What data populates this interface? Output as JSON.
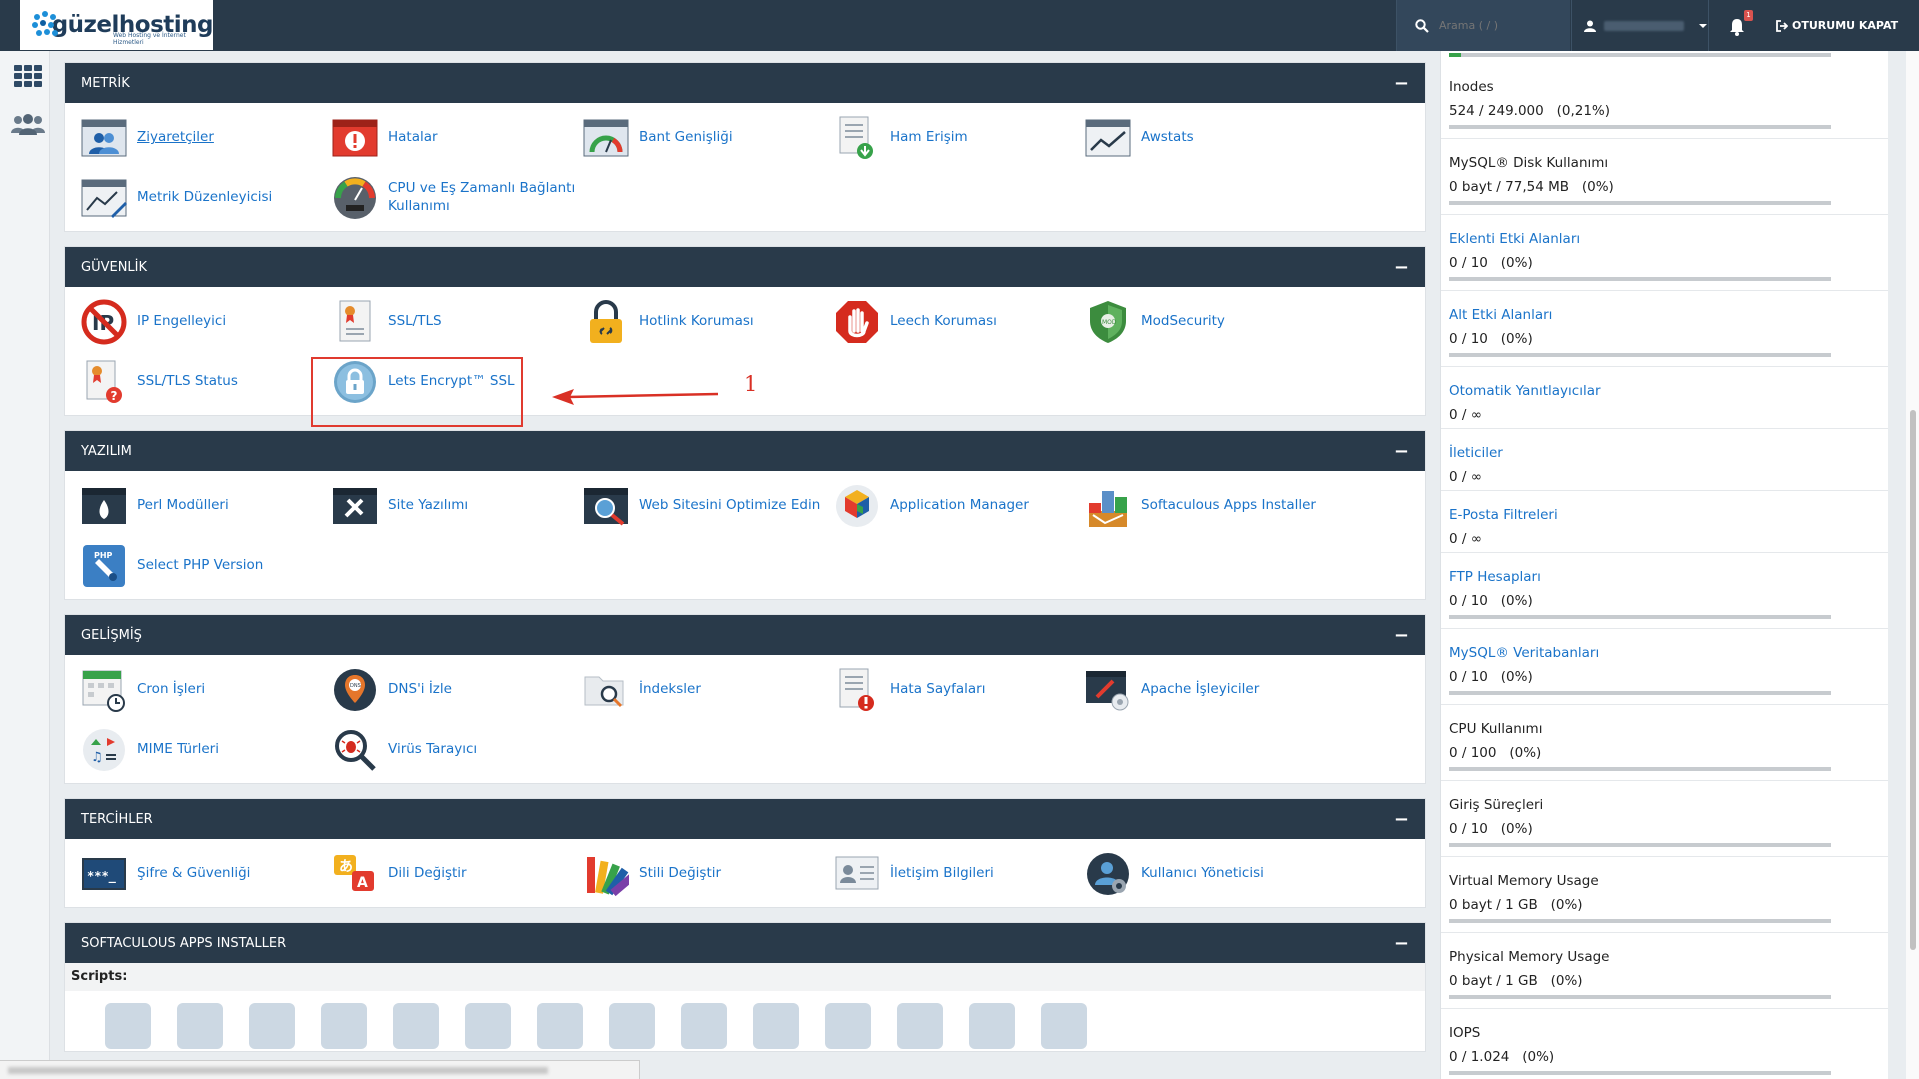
{
  "topbar": {
    "logo_text": "güzelhosting",
    "logo_sub": "Web Hosting ve İnternet Hizmetleri",
    "search_placeholder": "Arama ( / )",
    "notification_count": "1",
    "logout_label": "OTURUMU KAPAT"
  },
  "sections": [
    {
      "title": "METRİK",
      "items": [
        {
          "label": "Ziyaretçiler",
          "icon": "visitors-icon"
        },
        {
          "label": "Hatalar",
          "icon": "errors-icon"
        },
        {
          "label": "Bant Genişliği",
          "icon": "bandwidth-icon"
        },
        {
          "label": "Ham Erişim",
          "icon": "raw-access-icon"
        },
        {
          "label": "Awstats",
          "icon": "awstats-icon"
        },
        {
          "label": "Metrik Düzenleyicisi",
          "icon": "metrics-editor-icon"
        },
        {
          "label": "CPU ve Eş Zamanlı Bağlantı Kullanımı",
          "icon": "cpu-usage-icon"
        }
      ]
    },
    {
      "title": "GÜVENLİK",
      "items": [
        {
          "label": "IP Engelleyici",
          "icon": "ip-blocker-icon"
        },
        {
          "label": "SSL/TLS",
          "icon": "ssl-tls-icon"
        },
        {
          "label": "Hotlink Koruması",
          "icon": "hotlink-lock-icon"
        },
        {
          "label": "Leech Koruması",
          "icon": "leech-hand-icon"
        },
        {
          "label": "ModSecurity",
          "icon": "modsecurity-shield-icon"
        },
        {
          "label": "SSL/TLS Status",
          "icon": "ssl-status-icon"
        },
        {
          "label": "Lets Encrypt™ SSL",
          "icon": "lets-encrypt-lock-icon"
        }
      ]
    },
    {
      "title": "YAZILIM",
      "items": [
        {
          "label": "Perl Modülleri",
          "icon": "perl-icon"
        },
        {
          "label": "Site Yazılımı",
          "icon": "site-software-icon"
        },
        {
          "label": "Web Sitesini Optimize Edin",
          "icon": "optimize-icon"
        },
        {
          "label": "Application Manager",
          "icon": "app-manager-icon"
        },
        {
          "label": "Softaculous Apps Installer",
          "icon": "softaculous-icon"
        },
        {
          "label": "Select PHP Version",
          "icon": "php-icon"
        }
      ]
    },
    {
      "title": "GELİŞMİŞ",
      "items": [
        {
          "label": "Cron İşleri",
          "icon": "cron-calendar-icon"
        },
        {
          "label": "DNS'i İzle",
          "icon": "dns-pin-icon"
        },
        {
          "label": "İndeksler",
          "icon": "indexes-folder-icon"
        },
        {
          "label": "Hata Sayfaları",
          "icon": "error-pages-icon"
        },
        {
          "label": "Apache İşleyiciler",
          "icon": "apache-handlers-icon"
        },
        {
          "label": "MIME Türleri",
          "icon": "mime-types-icon"
        },
        {
          "label": "Virüs Tarayıcı",
          "icon": "virus-scanner-icon"
        }
      ]
    },
    {
      "title": "TERCİHLER",
      "items": [
        {
          "label": "Şifre & Güvenliği",
          "icon": "password-icon"
        },
        {
          "label": "Dili Değiştir",
          "icon": "language-icon"
        },
        {
          "label": "Stili Değiştir",
          "icon": "style-palette-icon"
        },
        {
          "label": "İletişim Bilgileri",
          "icon": "contact-card-icon"
        },
        {
          "label": "Kullanıcı Yöneticisi",
          "icon": "user-manager-icon"
        }
      ]
    }
  ],
  "softaculous": {
    "title": "SOFTACULOUS APPS INSTALLER",
    "scripts_label": "Scripts:"
  },
  "annotation": {
    "number": "1"
  },
  "stats": [
    {
      "name": "Inodes",
      "value": "524 / 249.000   (0,21%)",
      "link": false,
      "bar": true
    },
    {
      "name": "MySQL® Disk Kullanımı",
      "value": "0 bayt / 77,54 MB   (0%)",
      "link": false,
      "bar": true
    },
    {
      "name": "Eklenti Etki Alanları",
      "value": "0 / 10   (0%)",
      "link": true,
      "bar": true
    },
    {
      "name": "Alt Etki Alanları",
      "value": "0 / 10   (0%)",
      "link": true,
      "bar": true
    },
    {
      "name": "Otomatik Yanıtlayıcılar",
      "value": "0 / ∞",
      "link": true,
      "bar": false
    },
    {
      "name": "İleticiler",
      "value": "0 / ∞",
      "link": true,
      "bar": false
    },
    {
      "name": "E-Posta Filtreleri",
      "value": "0 / ∞",
      "link": true,
      "bar": false
    },
    {
      "name": "FTP Hesapları",
      "value": "0 / 10   (0%)",
      "link": true,
      "bar": true
    },
    {
      "name": "MySQL® Veritabanları",
      "value": "0 / 10   (0%)",
      "link": true,
      "bar": true
    },
    {
      "name": "CPU Kullanımı",
      "value": "0 / 100   (0%)",
      "link": false,
      "bar": true
    },
    {
      "name": "Giriş Süreçleri",
      "value": "0 / 10   (0%)",
      "link": false,
      "bar": true
    },
    {
      "name": "Virtual Memory Usage",
      "value": "0 bayt / 1 GB   (0%)",
      "link": false,
      "bar": true
    },
    {
      "name": "Physical Memory Usage",
      "value": "0 bayt / 1 GB   (0%)",
      "link": false,
      "bar": true
    },
    {
      "name": "IOPS",
      "value": "0 / 1.024   (0%)",
      "link": false,
      "bar": true
    }
  ]
}
